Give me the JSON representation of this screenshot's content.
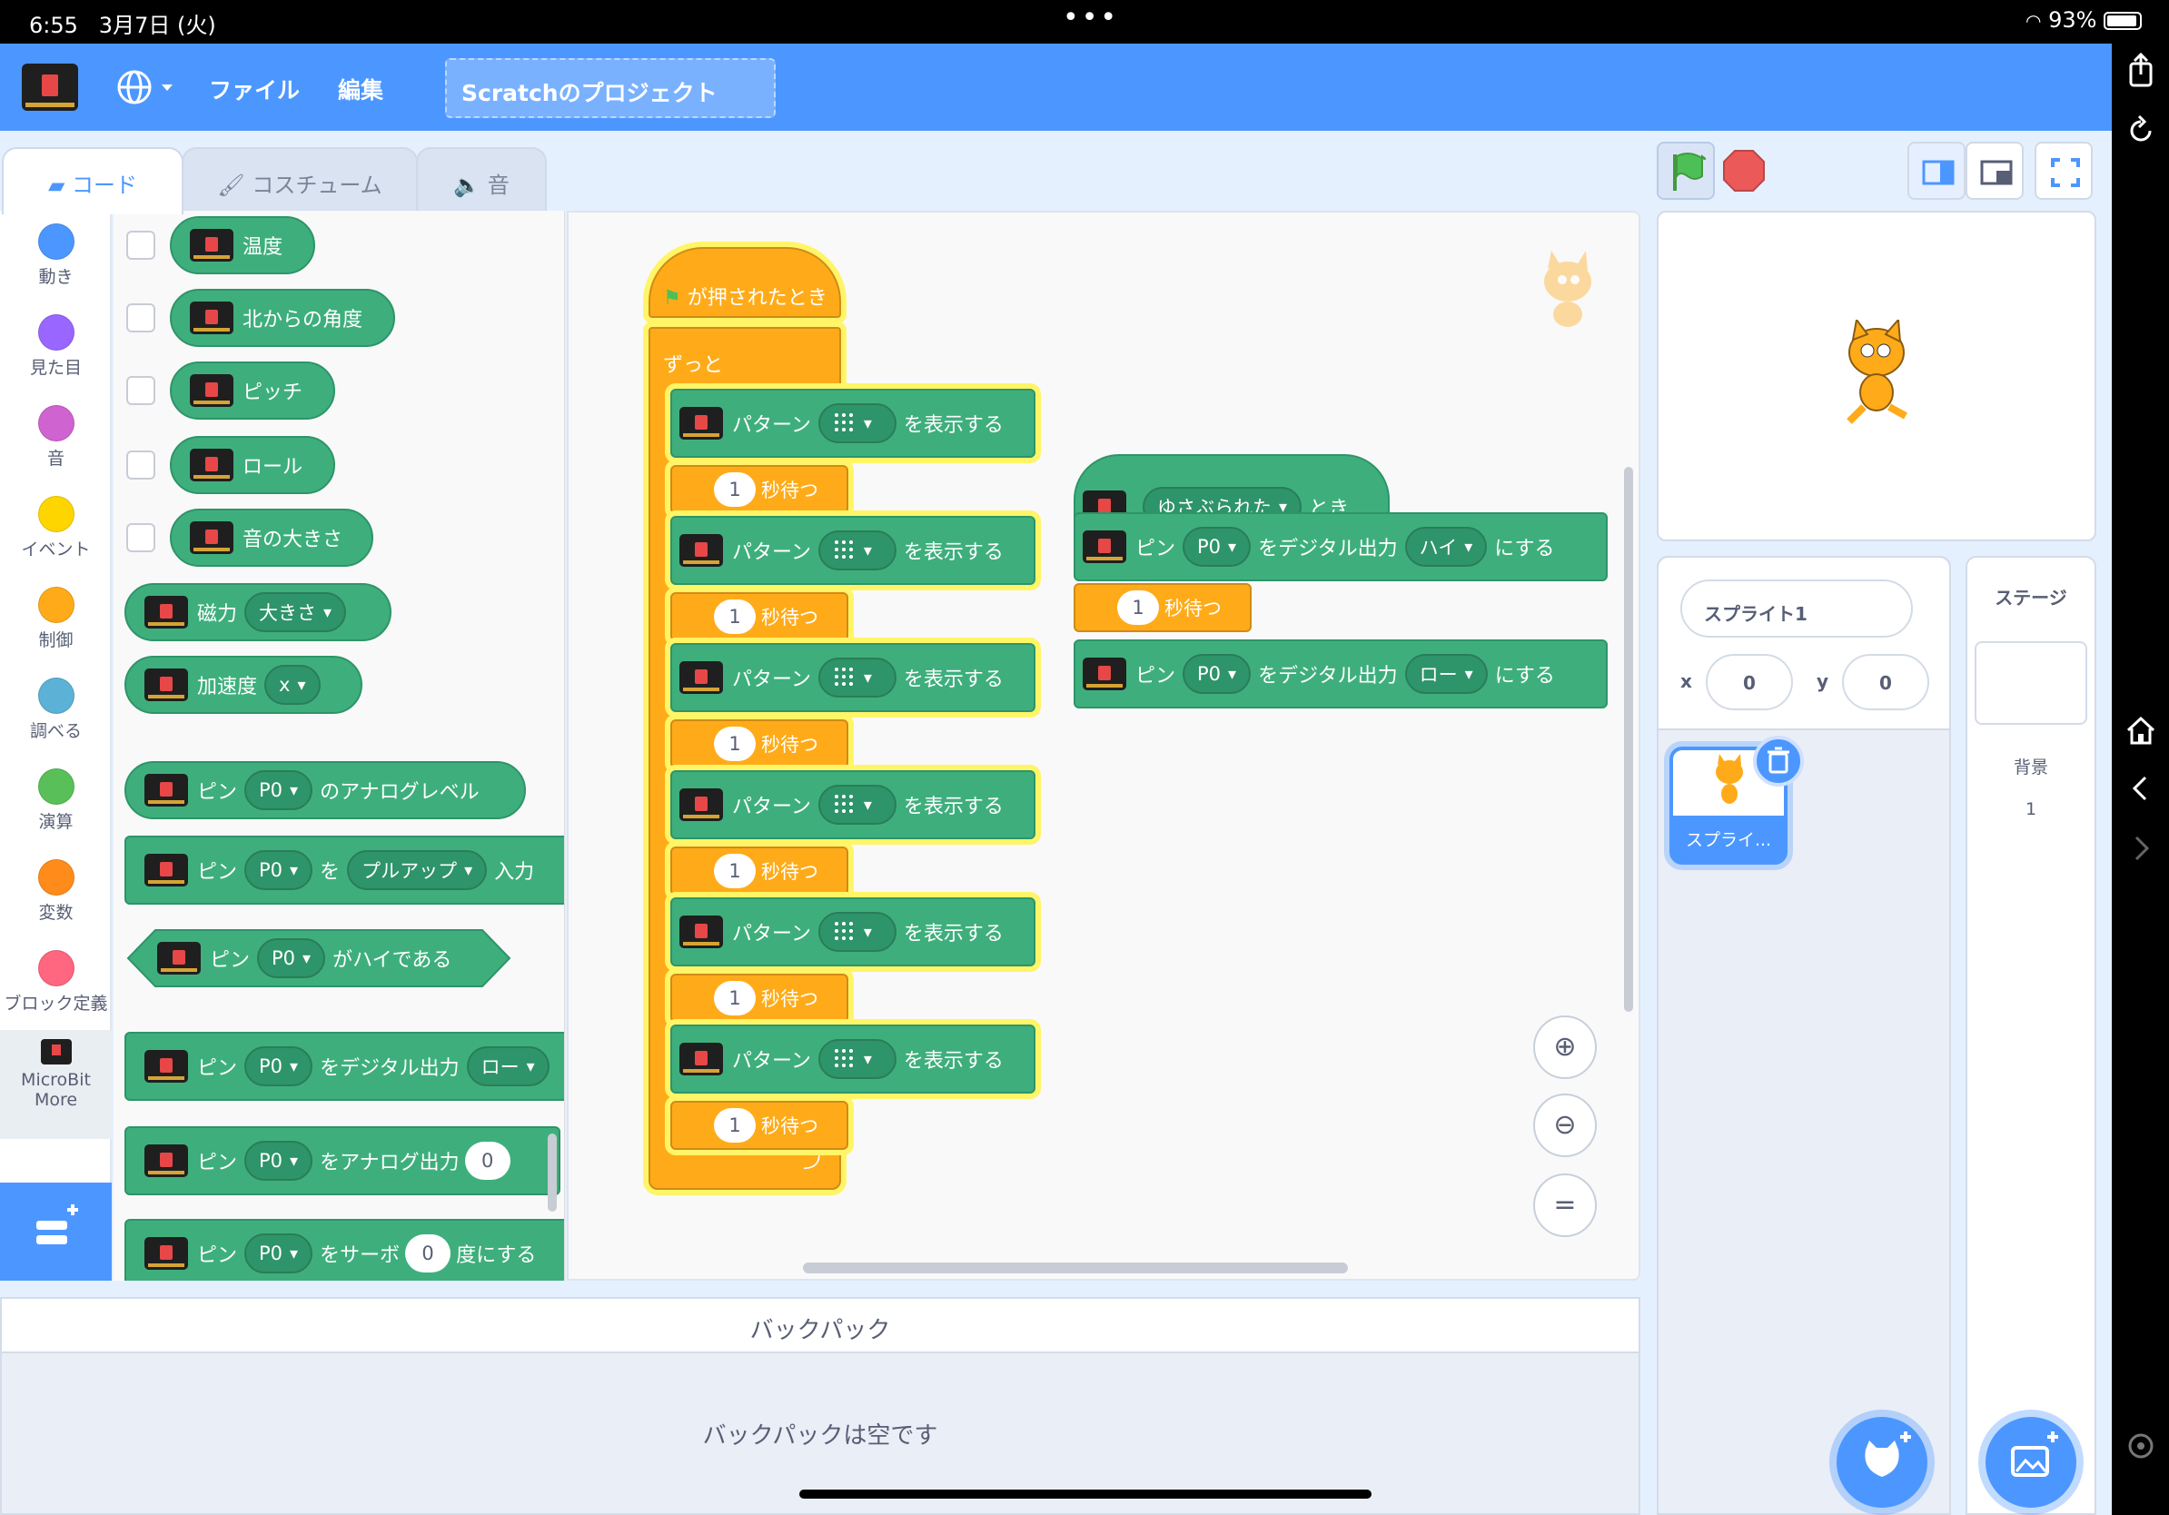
{
  "status_bar": {
    "time": "6:55",
    "date": "3月7日 (火)",
    "battery": "93%"
  },
  "menu": {
    "file": "ファイル",
    "edit": "編集",
    "project_title": "Scratchのプロジェクト"
  },
  "tabs": {
    "code": "コード",
    "costume": "コスチューム",
    "sound": "音"
  },
  "categories": [
    {
      "label": "動き",
      "color": "#4c97ff"
    },
    {
      "label": "見た目",
      "color": "#9966ff"
    },
    {
      "label": "音",
      "color": "#cf63cf"
    },
    {
      "label": "イベント",
      "color": "#ffd500"
    },
    {
      "label": "制御",
      "color": "#ffab19"
    },
    {
      "label": "調べる",
      "color": "#5cb1d6"
    },
    {
      "label": "演算",
      "color": "#59c059"
    },
    {
      "label": "変数",
      "color": "#ff8c1a"
    },
    {
      "label": "ブロック定義",
      "color": "#ff6680"
    }
  ],
  "extension": {
    "line1": "MicroBit",
    "line2": "More"
  },
  "palette": {
    "temperature": "温度",
    "heading": "北からの角度",
    "pitch": "ピッチ",
    "roll": "ロール",
    "loudness": "音の大きさ",
    "magnetic": "磁力",
    "magnetic_opt": "大きさ",
    "accel": "加速度",
    "accel_opt": "x",
    "pin": "ピン",
    "pin_opt": "P0",
    "analog_level": "のアナログレベル",
    "wo": "を",
    "pullup": "プルアップ",
    "input_partial": "入力",
    "is_high": "がハイである",
    "digital_out": "をデジタル出力",
    "low_partial": "ロー",
    "analog_out": "をアナログ出力",
    "servo": "をサーボ",
    "degree": "度にする",
    "zero": "0"
  },
  "script1": {
    "hat": "が押されたとき",
    "forever": "ずっと",
    "pattern": "パターン",
    "show": "を表示する",
    "wait_num": "1",
    "wait_label": "秒待つ"
  },
  "script2": {
    "shaken": "ゆさぶられた",
    "when": "とき",
    "pin": "ピン",
    "pin_opt": "P0",
    "digital_out": "をデジタル出力",
    "high": "ハイ",
    "low": "ロー",
    "set": "にする",
    "wait_num": "1",
    "wait_label": "秒待つ"
  },
  "zoom": {
    "reset": "="
  },
  "backpack": {
    "title": "バックパック",
    "empty": "バックパックは空です"
  },
  "sprite": {
    "name": "スプライト1",
    "x_label": "x",
    "x": "0",
    "y_label": "y",
    "y": "0",
    "thumb_label": "スプライ..."
  },
  "stage_pane": {
    "title": "ステージ",
    "backdrop_label": "背景",
    "backdrop_count": "1"
  },
  "colors": {
    "accent": "#4c97ff",
    "extension_green": "#3eaf7c",
    "control_orange": "#ffab19",
    "glow": "#fff566"
  }
}
